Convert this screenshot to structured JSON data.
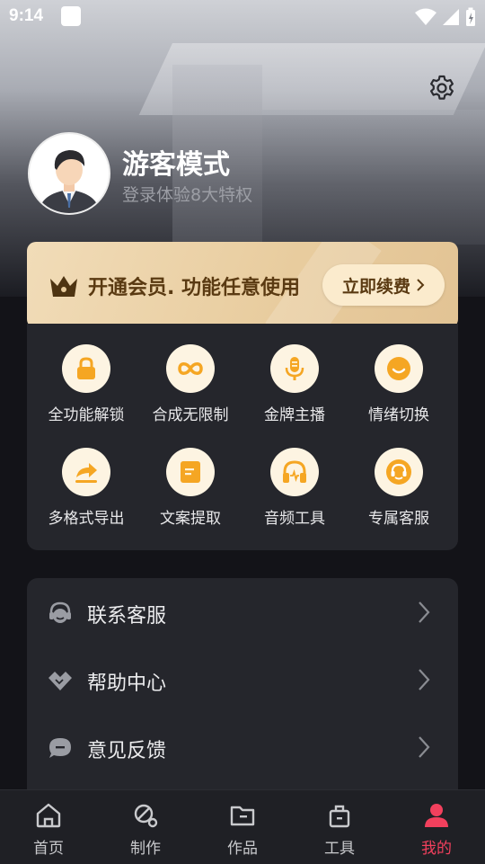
{
  "status_bar": {
    "time": "9:14"
  },
  "profile": {
    "name": "游客模式",
    "subtitle": "登录体验8大特权"
  },
  "vip_banner": {
    "text": "开通会员. 功能任意使用",
    "button_label": "立即续费"
  },
  "features": [
    {
      "label": "全功能解锁",
      "icon": "lock-icon"
    },
    {
      "label": "合成无限制",
      "icon": "infinity-icon"
    },
    {
      "label": "金牌主播",
      "icon": "microphone-icon"
    },
    {
      "label": "情绪切换",
      "icon": "smile-icon"
    },
    {
      "label": "多格式导出",
      "icon": "share-export-icon"
    },
    {
      "label": "文案提取",
      "icon": "document-icon"
    },
    {
      "label": "音频工具",
      "icon": "headphones-icon"
    },
    {
      "label": "专属客服",
      "icon": "customer-service-icon"
    }
  ],
  "menu": [
    {
      "label": "联系客服",
      "icon": "headset-icon"
    },
    {
      "label": "帮助中心",
      "icon": "handshake-icon"
    },
    {
      "label": "意见反馈",
      "icon": "chat-bubble-icon"
    }
  ],
  "tabs": [
    {
      "label": "首页",
      "icon": "home-icon",
      "active": false
    },
    {
      "label": "制作",
      "icon": "create-icon",
      "active": false
    },
    {
      "label": "作品",
      "icon": "folder-icon",
      "active": false
    },
    {
      "label": "工具",
      "icon": "toolbox-icon",
      "active": false
    },
    {
      "label": "我的",
      "icon": "user-icon",
      "active": true
    }
  ],
  "colors": {
    "accent": "#f2405d",
    "vip_gold": "#e8cc9e",
    "feature_icon": "#f5a623"
  }
}
